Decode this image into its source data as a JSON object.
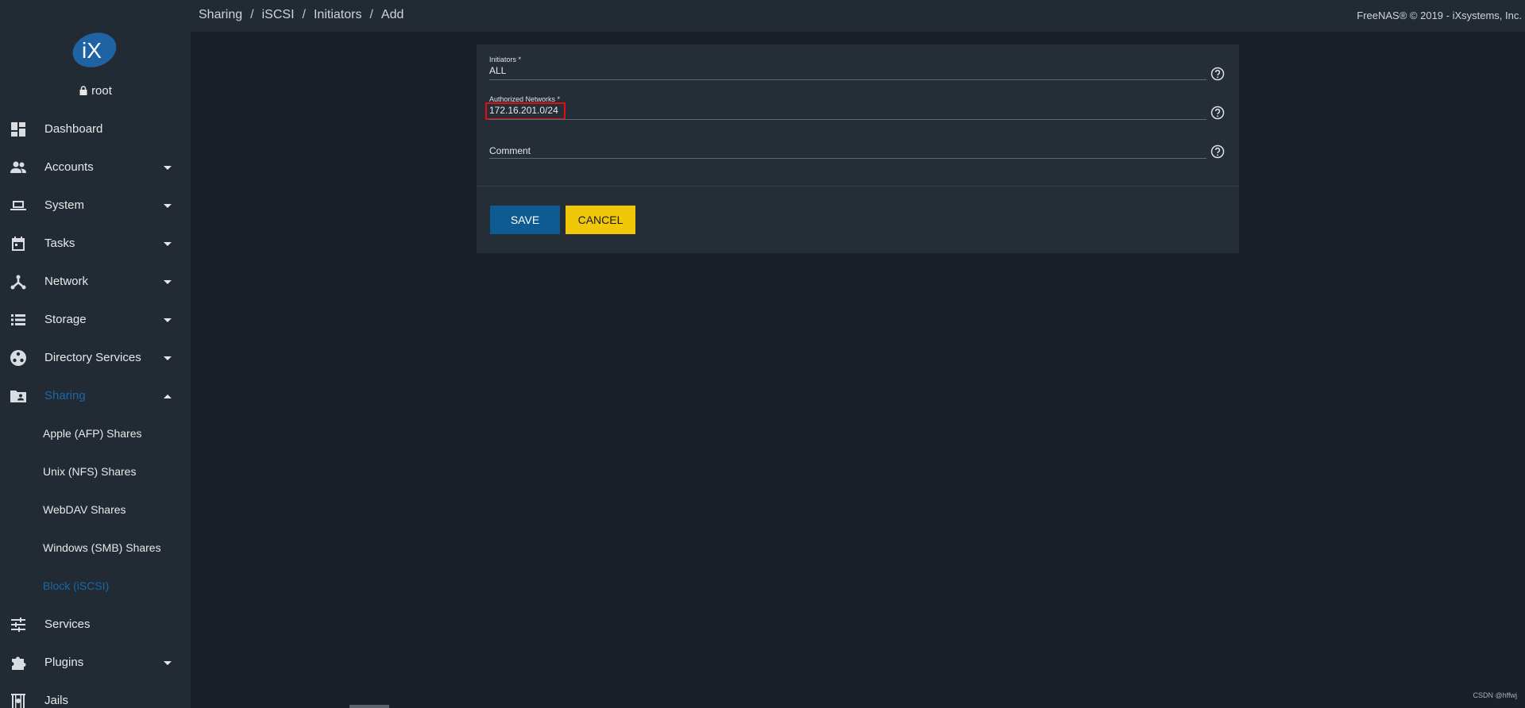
{
  "sidebar": {
    "user": "root",
    "items": [
      {
        "label": "Dashboard",
        "icon": "dashboard-icon",
        "expandable": false
      },
      {
        "label": "Accounts",
        "icon": "accounts-icon",
        "expandable": true
      },
      {
        "label": "System",
        "icon": "laptop-icon",
        "expandable": true
      },
      {
        "label": "Tasks",
        "icon": "calendar-icon",
        "expandable": true
      },
      {
        "label": "Network",
        "icon": "network-icon",
        "expandable": true
      },
      {
        "label": "Storage",
        "icon": "storage-icon",
        "expandable": true
      },
      {
        "label": "Directory Services",
        "icon": "directory-icon",
        "expandable": true
      },
      {
        "label": "Sharing",
        "icon": "folder-shared-icon",
        "expandable": true,
        "expanded": true,
        "active": true
      },
      {
        "label": "Services",
        "icon": "tune-icon",
        "expandable": false
      },
      {
        "label": "Plugins",
        "icon": "puzzle-icon",
        "expandable": true
      },
      {
        "label": "Jails",
        "icon": "jail-icon",
        "expandable": false
      }
    ],
    "sharing_sub": [
      {
        "label": "Apple (AFP) Shares"
      },
      {
        "label": "Unix (NFS) Shares"
      },
      {
        "label": "WebDAV Shares"
      },
      {
        "label": "Windows (SMB) Shares"
      },
      {
        "label": "Block (iSCSI)",
        "active": true
      }
    ]
  },
  "topbar": {
    "breadcrumb": [
      "Sharing",
      "iSCSI",
      "Initiators",
      "Add"
    ],
    "copyright": "FreeNAS® © 2019 - iXsystems, Inc."
  },
  "form": {
    "initiators": {
      "label": "Initiators *",
      "value": "ALL"
    },
    "authorized_networks": {
      "label": "Authorized Networks *",
      "value": "172.16.201.0/24",
      "highlighted": true
    },
    "comment": {
      "label": "Comment",
      "value": ""
    },
    "save_label": "SAVE",
    "cancel_label": "CANCEL"
  },
  "colors": {
    "sidebar_bg": "#222b34",
    "content_bg": "#1a2027",
    "card_bg": "#252e37",
    "active_blue": "#1769a8",
    "save_blue": "#0e5b93",
    "cancel_yellow": "#f0c808",
    "highlight_red": "#e01010"
  },
  "watermark": "CSDN @hffwj"
}
